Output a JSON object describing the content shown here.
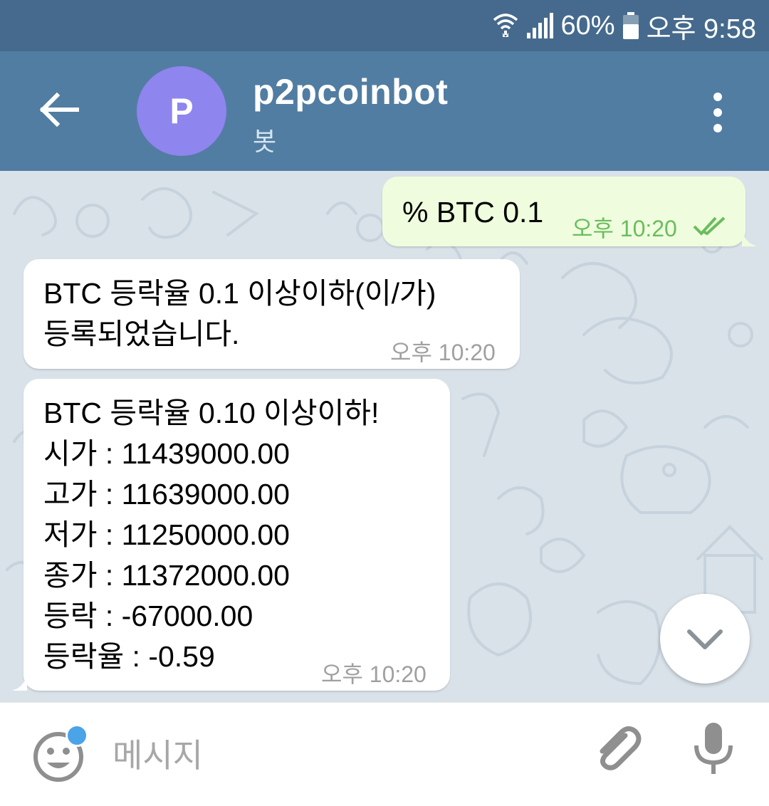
{
  "status_bar": {
    "battery": "60%",
    "time": "오후 9:58",
    "wifi_icon": "wifi-icon",
    "signal_icon": "signal-icon",
    "battery_icon": "battery-icon"
  },
  "header": {
    "avatar_letter": "P",
    "title": "p2pcoinbot",
    "subtitle": "봇",
    "back_icon": "arrow-left-icon",
    "more_icon": "more-vert-icon",
    "avatar_color": "#8e85ee",
    "bar_color": "#517da2"
  },
  "messages": [
    {
      "direction": "outgoing",
      "text": "% BTC 0.1",
      "time": "오후 10:20",
      "status_icon": "double-check-icon"
    },
    {
      "direction": "incoming",
      "text": "BTC 등락율 0.1 이상이하(이/가)\n등록되었습니다.",
      "time": "오후 10:20"
    },
    {
      "direction": "incoming",
      "text": "BTC 등락율 0.10 이상이하!\n시가 : 11439000.00\n고가 : 11639000.00\n저가 : 11250000.00\n종가 : 11372000.00\n등락 : -67000.00\n등락율 : -0.59",
      "time": "오후 10:20"
    }
  ],
  "input": {
    "placeholder": "메시지",
    "value": "",
    "emoji_icon": "emoji-icon",
    "attach_icon": "paperclip-icon",
    "mic_icon": "microphone-icon"
  },
  "scroll_down_icon": "chevron-down-icon",
  "colors": {
    "outgoing_bubble": "#effdde",
    "incoming_bubble": "#ffffff",
    "outgoing_time": "#6abd5d",
    "chat_background": "#d9e2e9"
  }
}
